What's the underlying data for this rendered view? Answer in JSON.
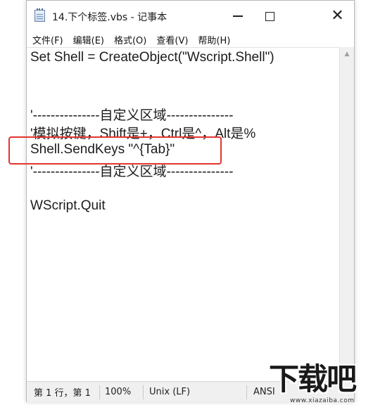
{
  "window": {
    "title": "14.下个标签.vbs - 记事本",
    "icon": "notepad-icon"
  },
  "menu": [
    {
      "label": "文件(F)"
    },
    {
      "label": "编辑(E)"
    },
    {
      "label": "格式(O)"
    },
    {
      "label": "查看(V)"
    },
    {
      "label": "帮助(H)"
    }
  ],
  "editor": {
    "lines": [
      "Set Shell = CreateObject(\"Wscript.Shell\")",
      "'---------------自定义区域---------------",
      "'模拟按键，Shift是+，Ctrl是^，Alt是%",
      "Shell.SendKeys \"^{Tab}\"",
      "'---------------自定义区域---------------",
      "WScript.Quit"
    ],
    "highlight_color": "#e3342f"
  },
  "status": {
    "position": "第 1 行，第 1",
    "zoom": "100%",
    "eol": "Unix (LF)",
    "encoding": "ANSI"
  },
  "watermark": {
    "logo_text": "下载吧",
    "url": "www.xiazaiba.com"
  }
}
